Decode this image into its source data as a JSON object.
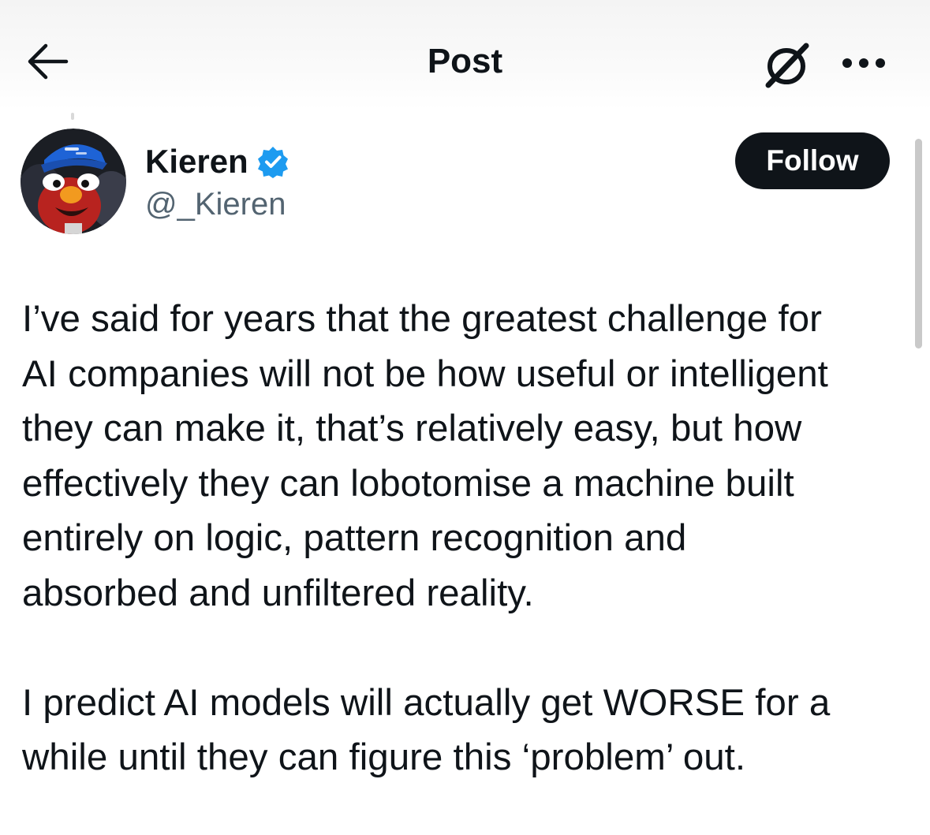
{
  "header": {
    "title": "Post",
    "back_icon": "arrow-left-icon",
    "grok_icon": "grok-icon",
    "more_icon": "more-horizontal-icon"
  },
  "author": {
    "display_name": "Kieren",
    "handle": "@_Kieren",
    "verified": true,
    "verified_color": "#1d9bf0",
    "avatar_icon": "avatar-image"
  },
  "follow_button": {
    "label": "Follow",
    "background": "#0f1419",
    "text_color": "#ffffff"
  },
  "post": {
    "paragraphs": [
      {
        "lines": [
          "I’ve said for years that the greatest challenge for",
          "AI companies will not be how useful or intelligent",
          "they can make it, that’s relatively easy, but how",
          "effectively they can lobotomise a machine built",
          "entirely on logic, pattern recognition and",
          "absorbed and unfiltered reality."
        ]
      },
      {
        "lines": [
          "I predict AI models will actually get WORSE for a",
          "while until they can figure this ‘problem’ out."
        ]
      }
    ]
  },
  "colors": {
    "text_primary": "#0f1419",
    "text_secondary": "#536471",
    "accent": "#1d9bf0"
  }
}
